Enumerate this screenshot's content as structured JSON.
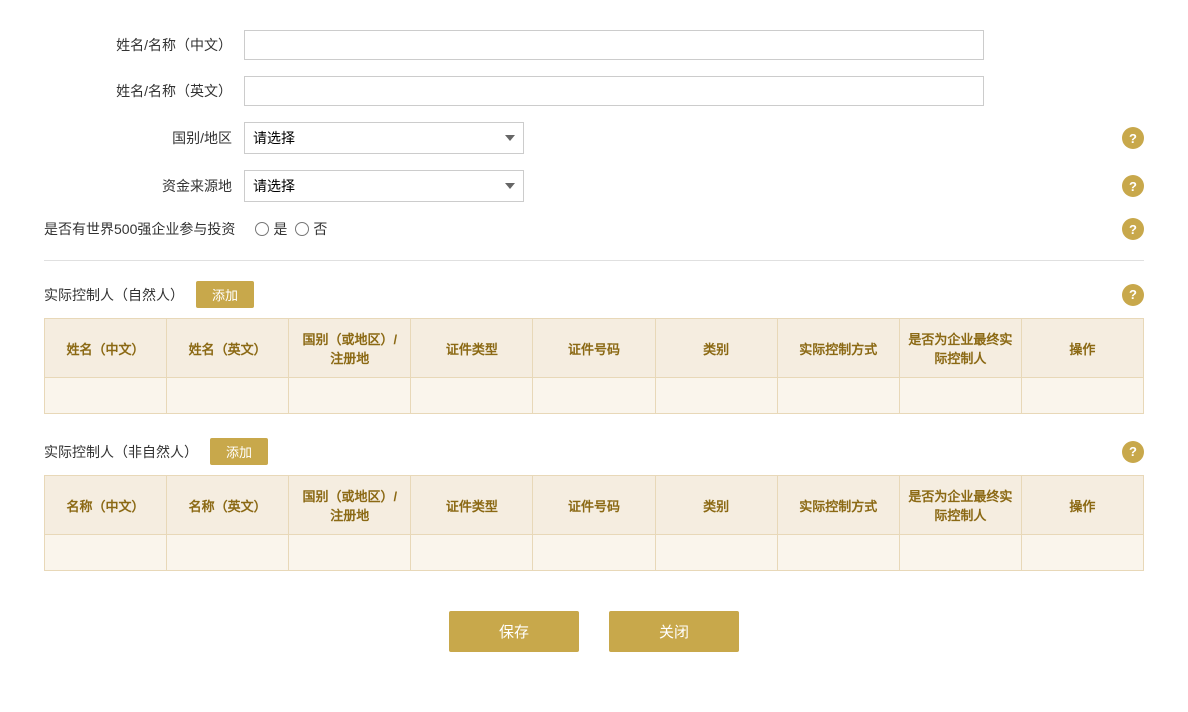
{
  "form": {
    "name_cn_label": "姓名/名称（中文）",
    "name_en_label": "姓名/名称（英文）",
    "country_label": "国别/地区",
    "country_placeholder": "请选择",
    "fund_source_label": "资金来源地",
    "fund_source_placeholder": "请选择",
    "world500_label": "是否有世界500强企业参与投资",
    "world500_yes": "是",
    "world500_no": "否"
  },
  "section1": {
    "title": "实际控制人（自然人）",
    "add_btn": "添加",
    "columns": [
      "姓名（中文）",
      "姓名（英文）",
      "国别（或地区）/注册地",
      "证件类型",
      "证件号码",
      "类别",
      "实际控制方式",
      "是否为企业最终实际控制人",
      "操作"
    ]
  },
  "section2": {
    "title": "实际控制人（非自然人）",
    "add_btn": "添加",
    "columns": [
      "名称（中文）",
      "名称（英文）",
      "国别（或地区）/注册地",
      "证件类型",
      "证件号码",
      "类别",
      "实际控制方式",
      "是否为企业最终实际控制人",
      "操作"
    ]
  },
  "buttons": {
    "save": "保存",
    "close": "关闭"
  },
  "icons": {
    "help": "?",
    "dropdown": "▼"
  }
}
